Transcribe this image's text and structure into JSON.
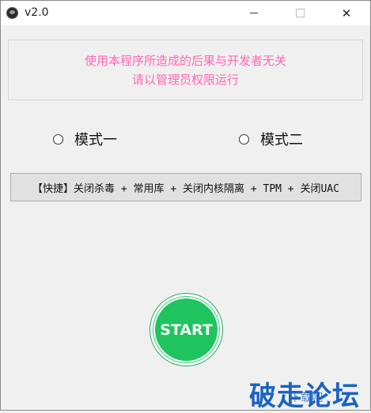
{
  "window": {
    "title": "v2.0",
    "close_symbol": "✕"
  },
  "notice": {
    "line1": "使用本程序所造成的后果与开发者无关",
    "line2": "请以管理员权限运行",
    "color": "#ff69b4"
  },
  "modes": [
    {
      "label": "模式一",
      "selected": false
    },
    {
      "label": "模式二",
      "selected": false
    }
  ],
  "quick_button": {
    "label": "【快捷】关闭杀毒 + 常用库 + 关闭内核隔离 + TPM + 关闭UAC"
  },
  "start_button": {
    "label": "START",
    "color": "#1fc45f"
  },
  "watermark": {
    "text": "破走论坛",
    "sub_text": "下载吧"
  }
}
